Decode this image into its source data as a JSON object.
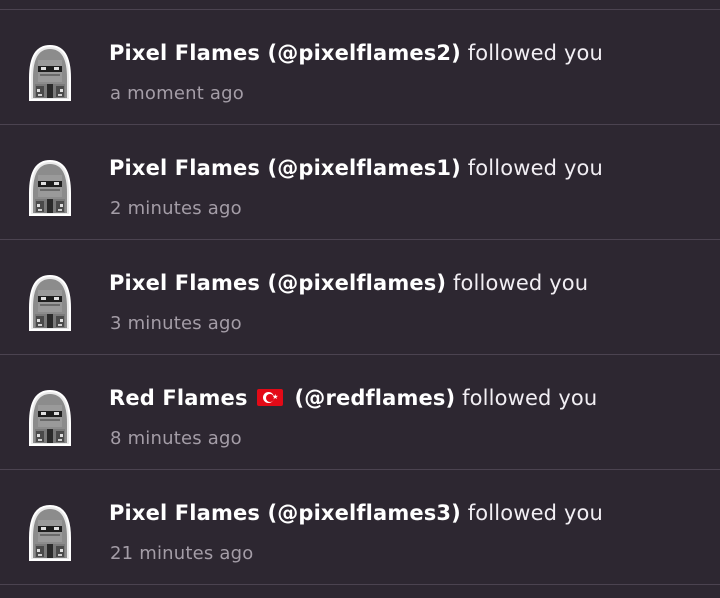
{
  "notifications": [
    {
      "name": "Pixel Flames",
      "handle": "(@pixelflames2)",
      "action": "followed you",
      "time": "a moment ago",
      "avatar_icon": "pixel-hooded-figure"
    },
    {
      "name": "Pixel Flames",
      "handle": "(@pixelflames1)",
      "action": "followed you",
      "time": "2 minutes ago",
      "avatar_icon": "pixel-hooded-figure"
    },
    {
      "name": "Pixel Flames",
      "handle": "(@pixelflames)",
      "action": "followed you",
      "time": "3 minutes ago",
      "avatar_icon": "pixel-hooded-figure"
    },
    {
      "name": "Red Flames",
      "flag": "turkey-flag-emoji",
      "handle": "(@redflames)",
      "action": "followed you",
      "time": "8 minutes ago",
      "avatar_icon": "pixel-hooded-figure"
    },
    {
      "name": "Pixel Flames",
      "handle": "(@pixelflames3)",
      "action": "followed you",
      "time": "21 minutes ago",
      "avatar_icon": "pixel-hooded-figure"
    }
  ],
  "colors": {
    "background": "#2d2731",
    "divider": "#4b4350",
    "primary_text": "#ffffff",
    "secondary_text": "#a49da7",
    "flag_red": "#e30a17"
  }
}
